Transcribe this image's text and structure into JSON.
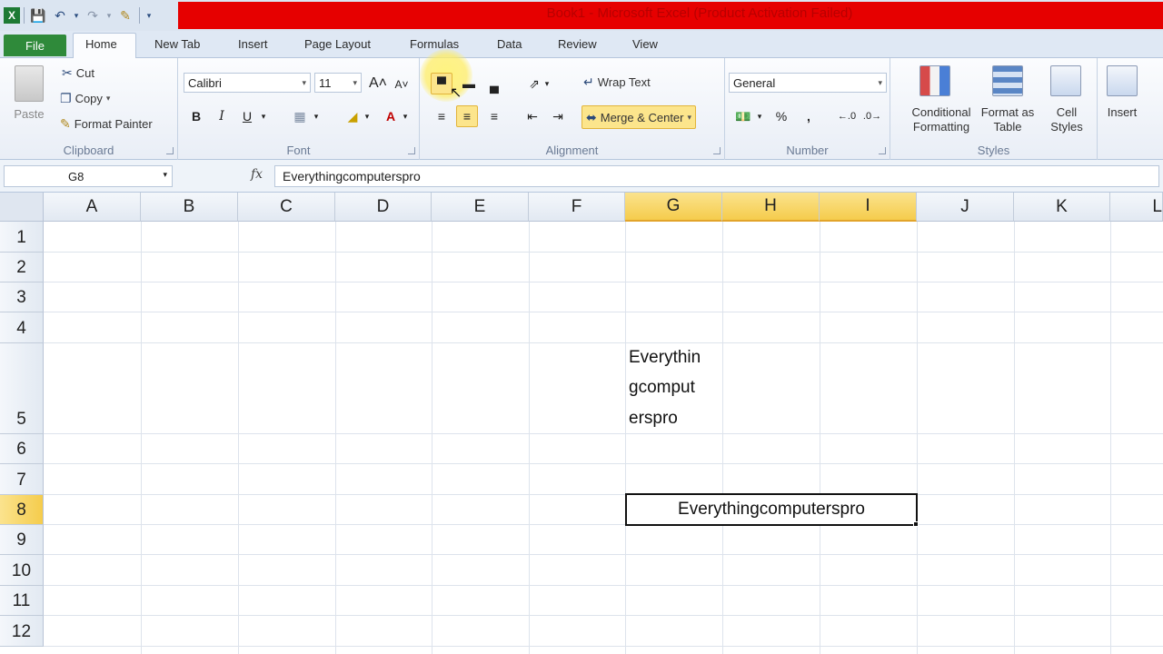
{
  "window": {
    "title": "Book1 - Microsoft Excel (Product Activation Failed)"
  },
  "tabs": [
    {
      "label": "File"
    },
    {
      "label": "Home"
    },
    {
      "label": "New Tab"
    },
    {
      "label": "Insert"
    },
    {
      "label": "Page Layout"
    },
    {
      "label": "Formulas"
    },
    {
      "label": "Data"
    },
    {
      "label": "Review"
    },
    {
      "label": "View"
    }
  ],
  "ribbon": {
    "clipboard": {
      "label": "Clipboard",
      "paste": "Paste",
      "cut": "Cut",
      "copy": "Copy",
      "format_painter": "Format Painter"
    },
    "font": {
      "label": "Font",
      "font_name": "Calibri",
      "font_size": "11",
      "bold": "B",
      "italic": "I",
      "underline": "U"
    },
    "alignment": {
      "label": "Alignment",
      "wrap_text": "Wrap Text",
      "merge_center": "Merge & Center"
    },
    "number": {
      "label": "Number",
      "format": "General",
      "percent": "%"
    },
    "styles": {
      "label": "Styles",
      "conditional_formatting": "Conditional Formatting",
      "format_as_table": "Format as Table",
      "cell_styles": "Cell Styles"
    },
    "cells": {
      "insert": "Insert"
    }
  },
  "formula_bar": {
    "name_box": "G8",
    "fx": "fx",
    "formula": "Everythingcomputerspro"
  },
  "grid": {
    "columns": [
      "A",
      "B",
      "C",
      "D",
      "E",
      "F",
      "G",
      "H",
      "I",
      "J",
      "K",
      "L"
    ],
    "rows": [
      "1",
      "2",
      "3",
      "4",
      "5",
      "6",
      "7",
      "8",
      "9",
      "10",
      "11",
      "12"
    ],
    "wrapped_cell_lines": [
      "Everythin",
      "gcomput",
      "erspro"
    ],
    "merged_cell_text": "Everythingcomputerspro"
  },
  "colors": {
    "title_bar_error": "#e60000",
    "file_tab": "#2f8a3a",
    "selected_header": "#f5cc4c"
  }
}
